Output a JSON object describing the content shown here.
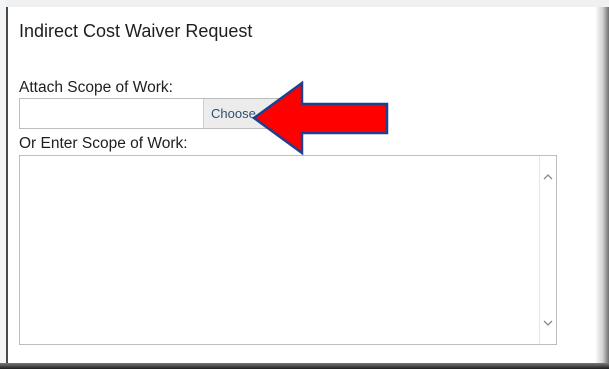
{
  "form": {
    "title": "Indirect Cost Waiver Request",
    "attach_label": "Attach Scope of Work:",
    "choose_button_label": "Choose",
    "enter_label": "Or Enter Scope of Work:",
    "file_value": "",
    "scope_text": ""
  },
  "icons": {
    "annotation_arrow": "left-pointing-arrow-icon",
    "scroll_up": "chevron-up-icon",
    "scroll_down": "chevron-down-icon"
  },
  "colors": {
    "arrow_fill": "#ff0000",
    "arrow_outline": "#1f3f8f",
    "button_text": "#2f4f6e"
  }
}
